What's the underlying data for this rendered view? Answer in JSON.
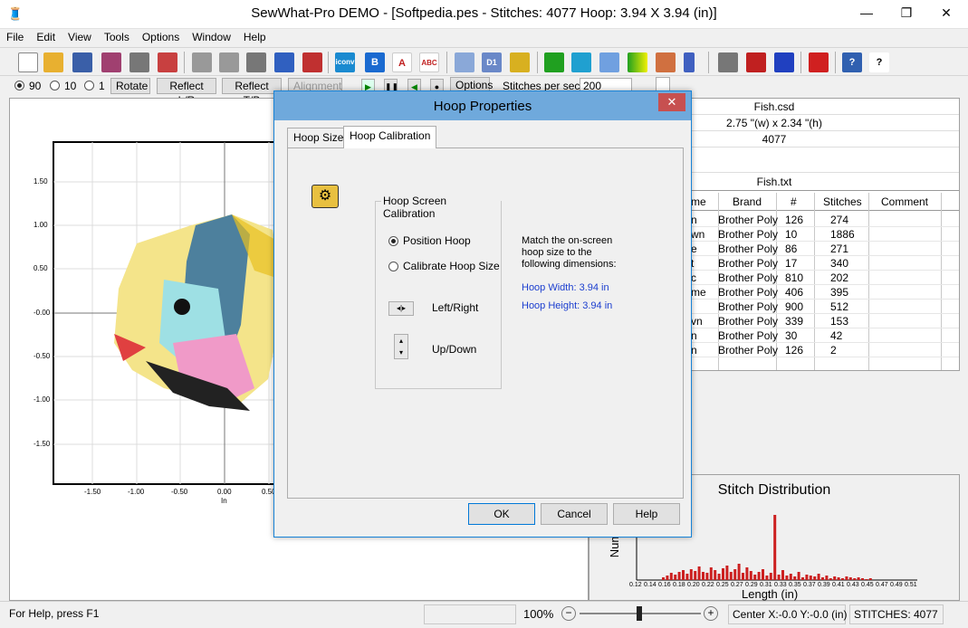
{
  "window": {
    "title": "SewWhat-Pro DEMO - [Softpedia.pes - Stitches: 4077  Hoop: 3.94 X 3.94 (in)]",
    "minimize": "—",
    "restore": "❐",
    "close": "✕"
  },
  "menu": [
    "File",
    "Edit",
    "View",
    "Tools",
    "Options",
    "Window",
    "Help"
  ],
  "toolbar2": {
    "rot90": "90",
    "rot10": "10",
    "rot1": "1",
    "rotate": "Rotate",
    "reflect_lr": "Reflect L/R",
    "reflect_tb": "Reflect T/B",
    "alignment": "Alignment",
    "options": "Options",
    "stitches_per_sec_label": "Stitches per sec",
    "stitches_per_sec_value": "200"
  },
  "canvas": {
    "y_ticks": [
      "1.50",
      "1.00",
      "0.50",
      "-0.00",
      "-0.50",
      "-1.00",
      "-1.50"
    ],
    "x_ticks": [
      "-1.50",
      "-1.00",
      "-0.50",
      "0.00",
      "0.50"
    ],
    "x_unit": "In"
  },
  "info": {
    "file": "Fish.csd",
    "size": "2.75 \"(w) x 2.34 \"(h)",
    "stitches": "4077",
    "thread_file": "Fish.txt"
  },
  "thread_table": {
    "headers": [
      "me",
      "Brand",
      "#",
      "Stitches",
      "Comment"
    ],
    "rows": [
      [
        "n",
        "Brother Poly",
        "126",
        "274",
        ""
      ],
      [
        "wn",
        "Brother Poly",
        "10",
        "1886",
        ""
      ],
      [
        "e",
        "Brother Poly",
        "86",
        "271",
        ""
      ],
      [
        "t",
        "Brother Poly",
        "17",
        "340",
        ""
      ],
      [
        "c",
        "Brother Poly",
        "810",
        "202",
        ""
      ],
      [
        "me",
        "Brother Poly",
        "406",
        "395",
        ""
      ],
      [
        "",
        "Brother Poly",
        "900",
        "512",
        ""
      ],
      [
        "vn",
        "Brother Poly",
        "339",
        "153",
        ""
      ],
      [
        "n",
        "Brother Poly",
        "30",
        "42",
        ""
      ],
      [
        "n",
        "Brother Poly",
        "126",
        "2",
        ""
      ]
    ]
  },
  "histogram": {
    "title": "Stitch Distribution",
    "xlabel": "Length (in)",
    "ylabel": "Num",
    "x_ticks": [
      "0.12",
      "0.14",
      "0.16",
      "0.18",
      "0.20",
      "0.22",
      "0.25",
      "0.27",
      "0.29",
      "0.31",
      "0.33",
      "0.35",
      "0.37",
      "0.39",
      "0.41",
      "0.43",
      "0.45",
      "0.47",
      "0.49",
      "0.51"
    ]
  },
  "status": {
    "help": "For Help, press F1",
    "zoom": "100%",
    "center": "Center X:-0.0 Y:-0.0 (in)",
    "stitches": "STITCHES:  4077"
  },
  "dialog": {
    "title": "Hoop Properties",
    "close": "✕",
    "tabs": [
      "Hoop Size",
      "Hoop Calibration"
    ],
    "group_title": "Hoop Screen Calibration",
    "position_hoop": "Position Hoop",
    "calibrate_hoop": "Calibrate Hoop Size",
    "left_right": "Left/Right",
    "up_down": "Up/Down",
    "instruction": "Match the on-screen hoop size to the following dimensions:",
    "hoop_width": "Hoop Width: 3.94 in",
    "hoop_height": "Hoop Height: 3.94 in",
    "ok": "OK",
    "cancel": "Cancel",
    "help": "Help"
  },
  "colors": {
    "accent": "#1883d7",
    "dialog_title": "#6fa9dc",
    "close_red": "#c75050",
    "hist_red": "#cc2020"
  }
}
